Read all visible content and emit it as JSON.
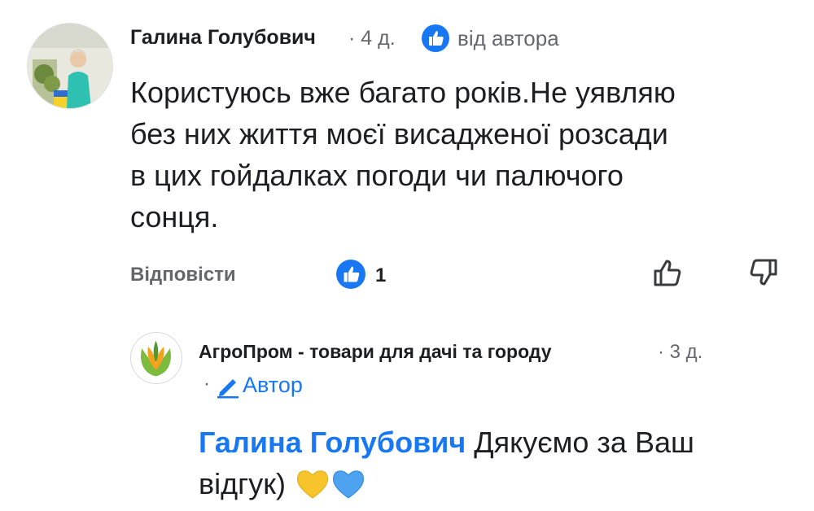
{
  "comment": {
    "author": "Галина Голубович",
    "meta": "· 4 д.",
    "badge_icon": "like-badge-icon",
    "by_author_label": "від автора",
    "text": "Користуюсь вже багато років.Не уявляю\nбез них життя моєї висадженої розсади\nв цих гойдалках погоди чи палючого\nсонця.",
    "reply_label": "Відповісти",
    "like_count": "1",
    "accent": "#1877f2"
  },
  "reply": {
    "author": "АгроПром - товари для дачі та городу",
    "meta": "· 3 д.",
    "dot": "·",
    "author_tag": "Автор",
    "mention": "Галина Голубович",
    "text": " Дякуємо за Ваш відгук)",
    "hearts": [
      "yellow-heart-icon",
      "blue-heart-icon"
    ],
    "heart_colors": [
      "#f7c52b",
      "#4ea3f0"
    ]
  }
}
